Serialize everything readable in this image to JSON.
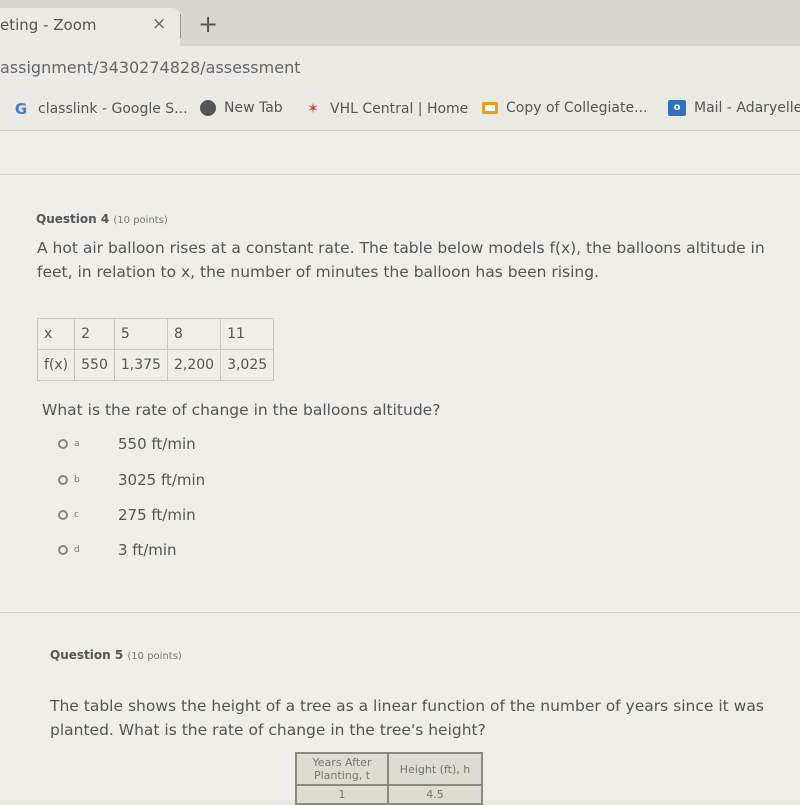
{
  "browser": {
    "tab_title": "eting - Zoom",
    "tab_close": "×",
    "new_tab": "+",
    "url": "assignment/3430274828/assessment",
    "bookmarks": [
      {
        "label": "classlink - Google S...",
        "icon": "G"
      },
      {
        "label": "New Tab",
        "icon": ""
      },
      {
        "label": "VHL Central | Home",
        "icon": "✶"
      },
      {
        "label": "Copy of Collegiate...",
        "icon": ""
      },
      {
        "label": "Mail - Adaryelle",
        "icon": "o"
      }
    ]
  },
  "question4": {
    "title": "Question 4",
    "points": "(10 points)",
    "text": "A hot air balloon rises at a constant rate. The table below models f(x), the balloons altitude in feet, in relation to x, the number of minutes the balloon has been rising.",
    "table": {
      "rows": [
        [
          "x",
          "2",
          "5",
          "8",
          "11"
        ],
        [
          "f(x)",
          "550",
          "1,375",
          "2,200",
          "3,025"
        ]
      ]
    },
    "prompt": "What is the rate of change in the balloons altitude?",
    "options": [
      {
        "letter": "a",
        "label": "550 ft/min"
      },
      {
        "letter": "b",
        "label": "3025 ft/min"
      },
      {
        "letter": "c",
        "label": "275 ft/min"
      },
      {
        "letter": "d",
        "label": "3 ft/min"
      }
    ]
  },
  "question5": {
    "title": "Question 5",
    "points": "(10 points)",
    "text": "The table shows the height of a tree as a linear function of the number of years since it was planted. What is the rate of change in the tree's height?",
    "table": {
      "headers": [
        "Years After Planting, t",
        "Height (ft), h"
      ],
      "rows": [
        [
          "1",
          "4.5"
        ]
      ]
    }
  }
}
